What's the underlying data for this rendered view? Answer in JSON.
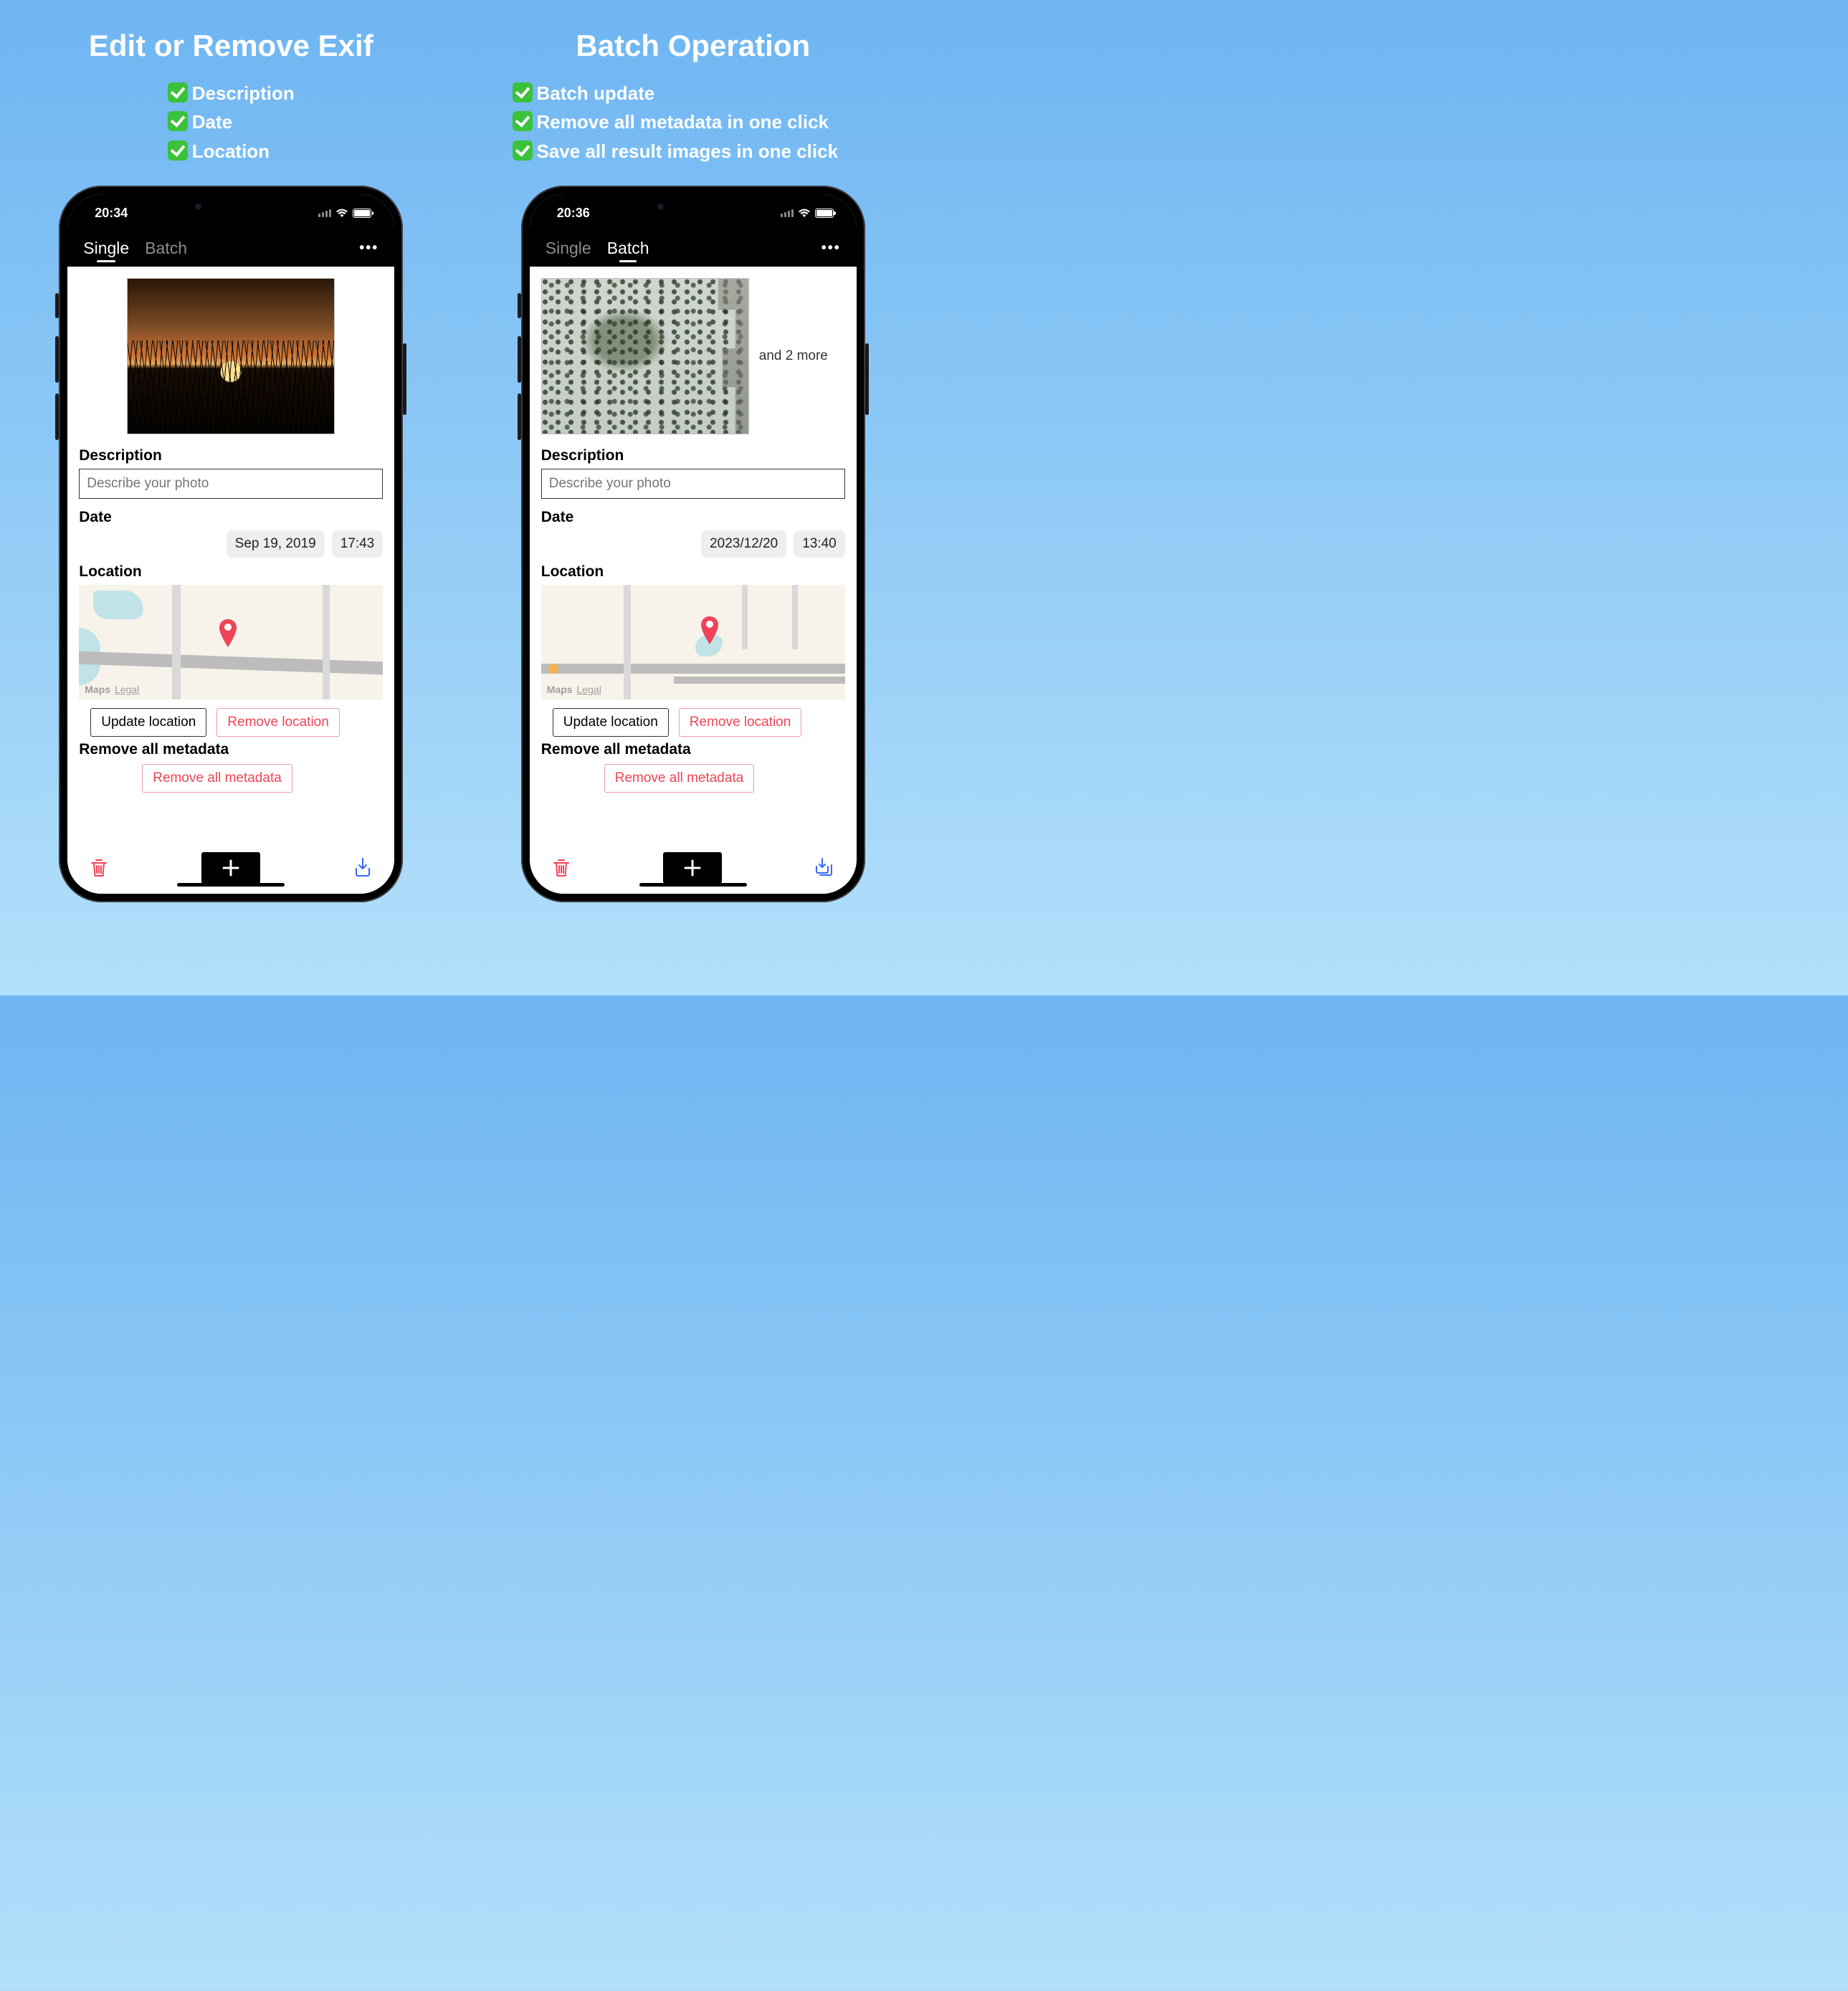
{
  "left": {
    "headline": "Edit or Remove Exif",
    "bullets": [
      "Description",
      "Date",
      "Location"
    ],
    "phone": {
      "time": "20:34",
      "tabs": {
        "single": "Single",
        "batch": "Batch",
        "active": "single"
      },
      "description_label": "Description",
      "description_placeholder": "Describe your photo",
      "date_label": "Date",
      "date_value": "Sep 19, 2019",
      "time_value": "17:43",
      "location_label": "Location",
      "map_attr": "Maps",
      "map_legal": "Legal",
      "update_location": "Update location",
      "remove_location": "Remove location",
      "remove_all_label": "Remove all metadata",
      "remove_all_button": "Remove all metadata"
    }
  },
  "right": {
    "headline": "Batch Operation",
    "bullets": [
      "Batch update",
      "Remove all metadata in one click",
      "Save all result images in one click"
    ],
    "phone": {
      "time": "20:36",
      "tabs": {
        "single": "Single",
        "batch": "Batch",
        "active": "batch"
      },
      "more_text": "and 2 more",
      "description_label": "Description",
      "description_placeholder": "Describe your photo",
      "date_label": "Date",
      "date_value": "2023/12/20",
      "time_value": "13:40",
      "location_label": "Location",
      "map_attr": "Maps",
      "map_legal": "Legal",
      "update_location": "Update location",
      "remove_location": "Remove location",
      "remove_all_label": "Remove all metadata",
      "remove_all_button": "Remove all metadata"
    }
  }
}
